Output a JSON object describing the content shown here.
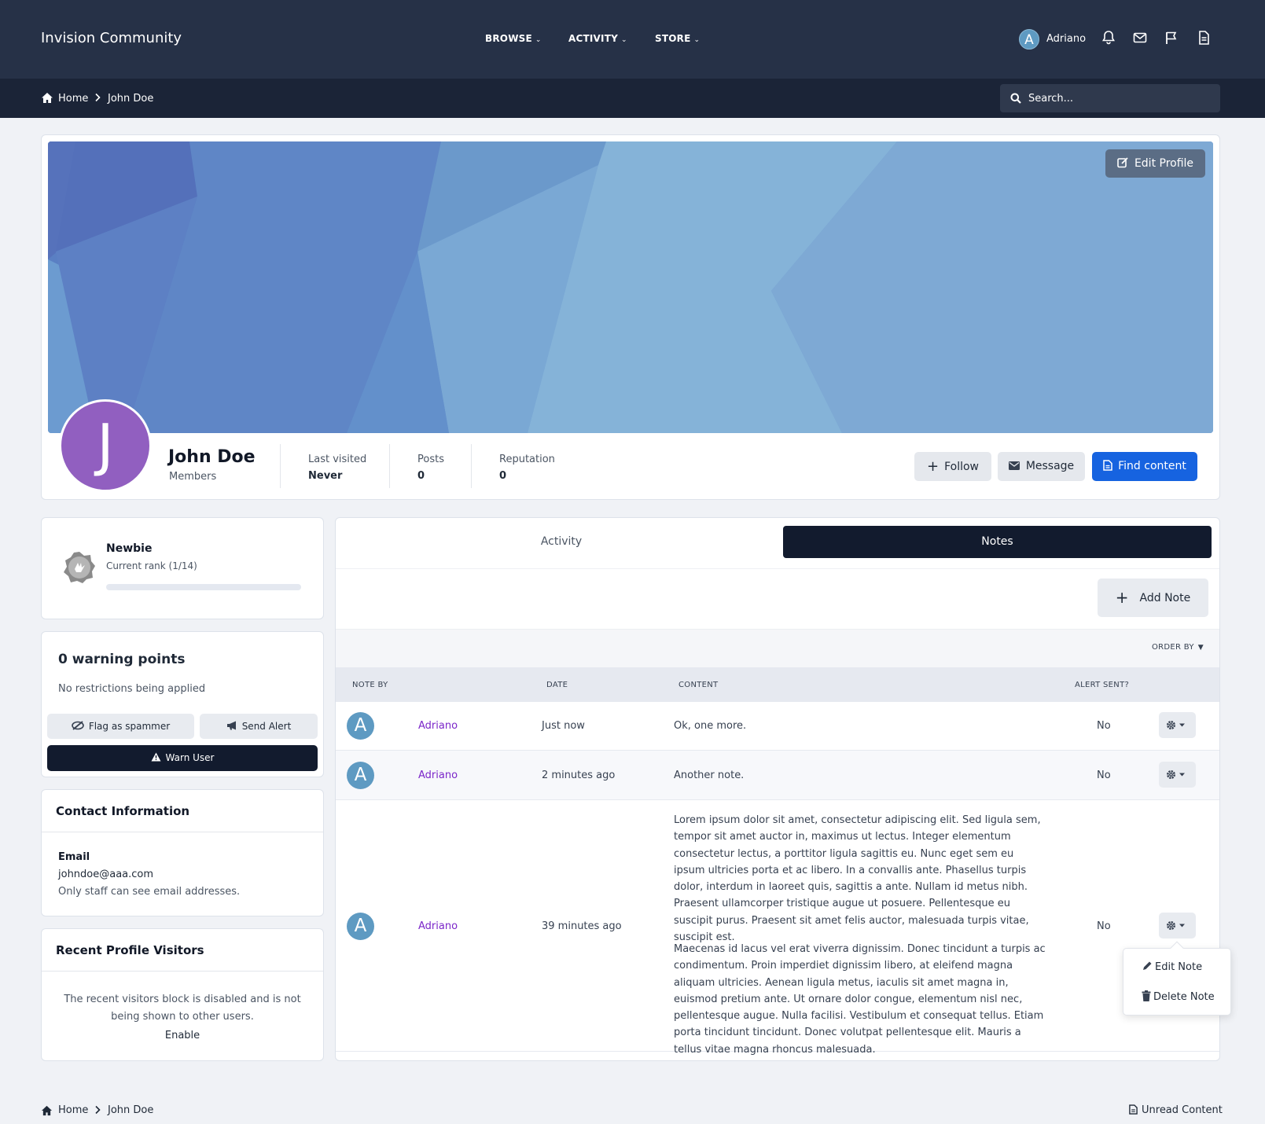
{
  "header": {
    "brand": "Invision Community",
    "nav": [
      {
        "label": "BROWSE"
      },
      {
        "label": "ACTIVITY"
      },
      {
        "label": "STORE"
      }
    ],
    "user": {
      "initial": "A",
      "name": "Adriano"
    },
    "icons": [
      "bell-icon",
      "envelope-icon",
      "flag-icon",
      "document-icon"
    ]
  },
  "breadcrumb": {
    "home": "Home",
    "current": "John Doe"
  },
  "search": {
    "placeholder": "Search..."
  },
  "profile": {
    "edit_label": "Edit Profile",
    "initial": "J",
    "name": "John Doe",
    "group": "Members",
    "stats": [
      {
        "label": "Last visited",
        "value": "Never"
      },
      {
        "label": "Posts",
        "value": "0"
      },
      {
        "label": "Reputation",
        "value": "0"
      }
    ],
    "actions": {
      "follow": "Follow",
      "message": "Message",
      "find": "Find content"
    },
    "avatar_color": "#915fc0",
    "cover_color": "#6c95c9"
  },
  "rank": {
    "name": "Newbie",
    "desc": "Current rank (1/14)",
    "progress": 0
  },
  "warnings": {
    "points": "0 warning points",
    "status": "No restrictions being applied",
    "flag_label": "Flag as spammer",
    "alert_label": "Send Alert",
    "warn_label": "Warn User"
  },
  "contact": {
    "title": "Contact Information",
    "email_label": "Email",
    "email": "johndoe@aaa.com",
    "note": "Only staff can see email addresses."
  },
  "visitors": {
    "title": "Recent Profile Visitors",
    "text": "The recent visitors block is disabled and is not being shown to other users.",
    "enable": "Enable"
  },
  "tabs": [
    {
      "label": "Activity",
      "active": false
    },
    {
      "label": "Notes",
      "active": true
    }
  ],
  "notes": {
    "add_label": "Add Note",
    "order_label": "ORDER BY",
    "columns": [
      "NOTE BY",
      "DATE",
      "CONTENT",
      "ALERT SENT?"
    ],
    "rows": [
      {
        "initial": "A",
        "author": "Adriano",
        "date": "Just now",
        "content": "Ok, one more.",
        "alert": "No"
      },
      {
        "initial": "A",
        "author": "Adriano",
        "date": "2 minutes ago",
        "content": "Another note.",
        "alert": "No"
      },
      {
        "initial": "A",
        "author": "Adriano",
        "date": "39 minutes ago",
        "content_p1": "Lorem ipsum dolor sit amet, consectetur adipiscing elit. Sed ligula sem, tempor sit amet auctor in, maximus ut lectus. Integer elementum consectetur lectus, a porttitor ligula sagittis eu. Nunc eget sem eu ipsum ultricies porta et ac libero. In a convallis ante. Phasellus turpis dolor, interdum in laoreet quis, sagittis a ante. Nullam id metus nibh. Praesent ullamcorper tristique augue ut posuere. Pellentesque eu suscipit purus. Praesent sit amet felis auctor, malesuada turpis vitae, suscipit est.",
        "content_p2": "Maecenas id lacus vel erat viverra dignissim. Donec tincidunt a turpis ac condimentum. Proin imperdiet dignissim libero, at eleifend magna aliquam ultricies. Aenean ligula metus, iaculis sit amet magna in, euismod pretium ante. Ut ornare dolor congue, elementum nisl nec, pellentesque augue. Nulla facilisi. Vestibulum et consequat tellus. Etiam porta tincidunt tincidunt. Donec volutpat pellentesque elit. Mauris a tellus vitae magna rhoncus malesuada.",
        "alert": "No"
      }
    ],
    "menu": {
      "edit": "Edit Note",
      "delete": "Delete Note"
    }
  },
  "footer": {
    "home": "Home",
    "current": "John Doe",
    "unread": "Unread Content"
  },
  "colors": {
    "header_bg": "#263147",
    "crumb_bg": "#1b2437",
    "primary": "#1663e0",
    "dark_button": "#121b2e",
    "author_link": "#7b26c9"
  }
}
